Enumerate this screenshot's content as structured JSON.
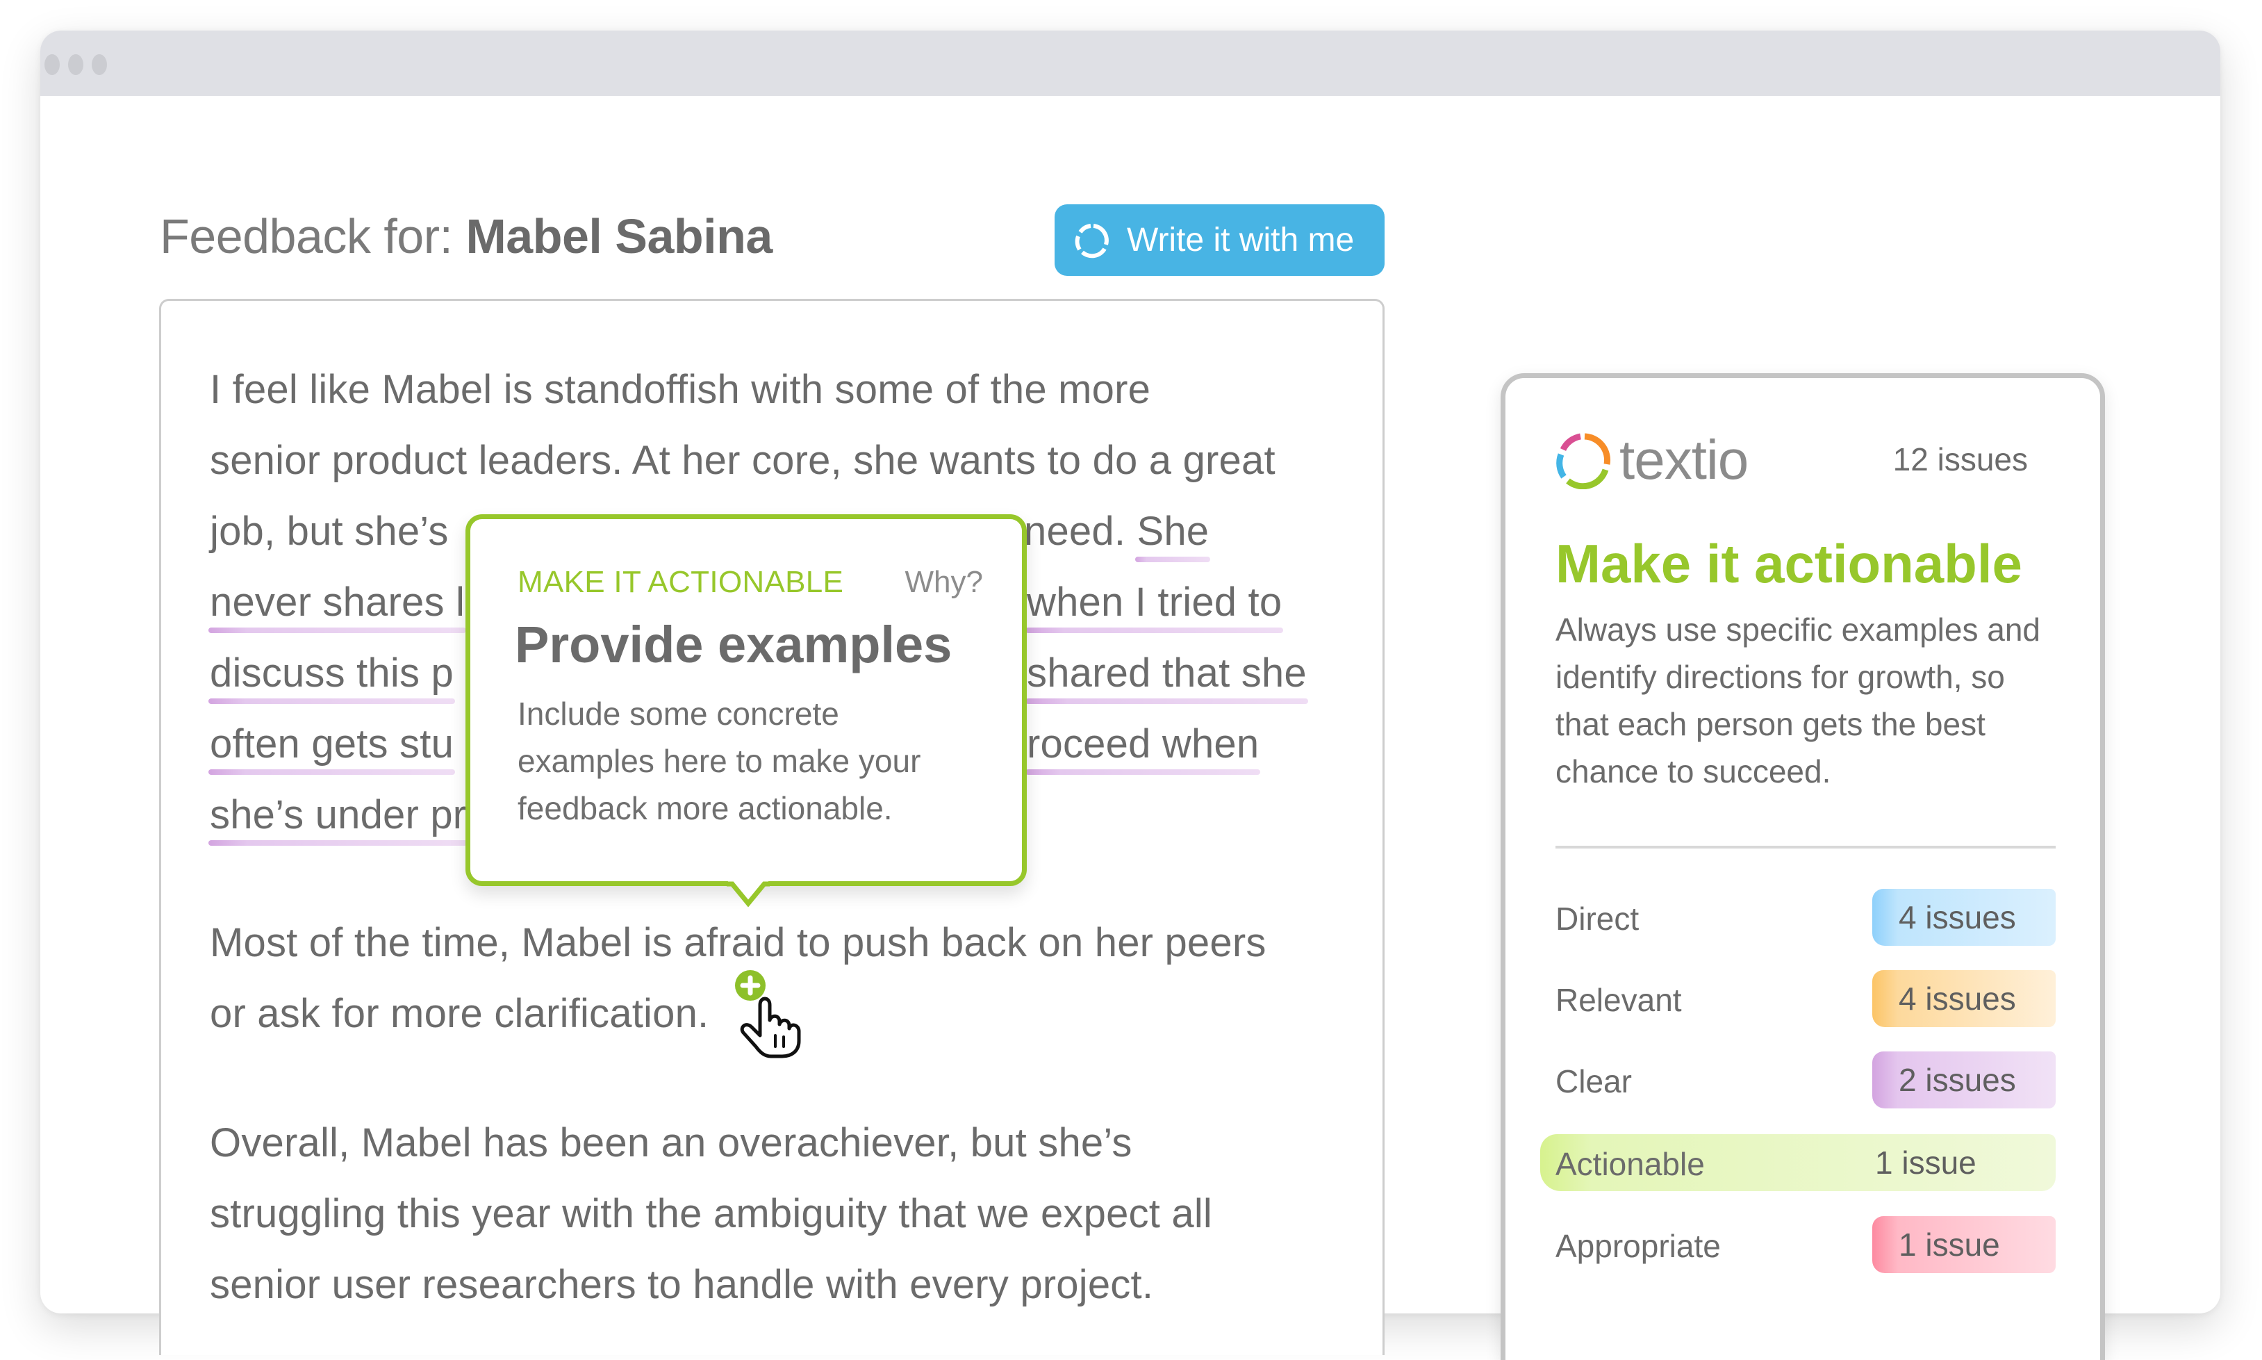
{
  "window": {
    "traffic_lights": [
      "dot",
      "dot",
      "dot"
    ]
  },
  "header": {
    "title_prefix": "Feedback for: ",
    "title_name": "Mabel Sabina",
    "write_button_label": "Write it with me",
    "write_button_icon": "textio-ring-icon",
    "accent_color": "#48b4e4"
  },
  "editor": {
    "paragraph1": {
      "lines": [
        {
          "segments": [
            {
              "text": "I feel like Mabel",
              "style": "highlight-blue"
            },
            {
              "text": " ",
              "style": "plain"
            },
            {
              "text": "is standoffish",
              "style": "highlight-orange"
            },
            {
              "text": " with some of the more",
              "style": "plain"
            }
          ]
        },
        {
          "segments": [
            {
              "text": "senior product leaders. At her core, she wants to do a great",
              "style": "plain"
            }
          ]
        },
        {
          "segments": [
            {
              "text": "job, but she’s",
              "style": "plain"
            }
          ],
          "right_segments": [
            {
              "text": "need. ",
              "style": "plain"
            },
            {
              "text": "She",
              "style": "underline-purple"
            }
          ]
        },
        {
          "segments": [
            {
              "text": "never shares l",
              "style": "underline-purple"
            }
          ],
          "right_segments": [
            {
              "text": "when I tried to",
              "style": "underline-purple"
            }
          ]
        },
        {
          "segments": [
            {
              "text": "discuss this p",
              "style": "underline-purple"
            }
          ],
          "right_segments": [
            {
              "text": "shared that she",
              "style": "underline-purple"
            }
          ]
        },
        {
          "segments": [
            {
              "text": "often gets stu",
              "style": "underline-purple"
            }
          ],
          "right_segments": [
            {
              "text": "roceed when",
              "style": "underline-purple"
            }
          ]
        },
        {
          "segments": [
            {
              "text": "she’s under pr",
              "style": "underline-purple"
            }
          ]
        }
      ]
    },
    "paragraph2": {
      "lines": [
        "Most of the time, Mabel is afraid to push back on her peers",
        "or ask for more clarification."
      ],
      "style": "highlight-green"
    },
    "paragraph3": {
      "line1_before": "Overall, Mabel has been an ",
      "line1_highlight": "overachiever,",
      "line1_after": " but she’s",
      "line2": "struggling this year with the ambiguity that we expect all",
      "line3": "senior user researchers to handle with every project."
    }
  },
  "popover": {
    "category": "MAKE IT ACTIONABLE",
    "why_link": "Why?",
    "title": "Provide examples",
    "body": "Include some concrete examples here to make your feedback more actionable.",
    "border_color": "#97c72b"
  },
  "cursor": {
    "icon": "hand-pointer-icon",
    "badge_icon": "plus-icon"
  },
  "sidebar": {
    "logo_text": "textio",
    "issues_total": "12 issues",
    "heading": "Make it actionable",
    "description": "Always use specific examples and identify directions for growth, so that each person gets the best chance to succeed.",
    "categories": [
      {
        "label": "Direct",
        "count": "4 issues",
        "color": "#8ed0fb"
      },
      {
        "label": "Relevant",
        "count": "4 issues",
        "color": "#fcc466"
      },
      {
        "label": "Clear",
        "count": "2 issues",
        "color": "#d3a4e0"
      },
      {
        "label": "Actionable",
        "count": "1 issue",
        "color": "#d5f08d",
        "selected": true
      },
      {
        "label": "Appropriate",
        "count": "1 issue",
        "color": "#fd8aa0"
      }
    ]
  },
  "colors": {
    "text": "#6b6b6b",
    "brand_green": "#97c72b",
    "logo_pink": "#d94f93",
    "logo_orange": "#f78d28",
    "logo_green": "#97c72b",
    "logo_blue": "#43b5e6"
  }
}
